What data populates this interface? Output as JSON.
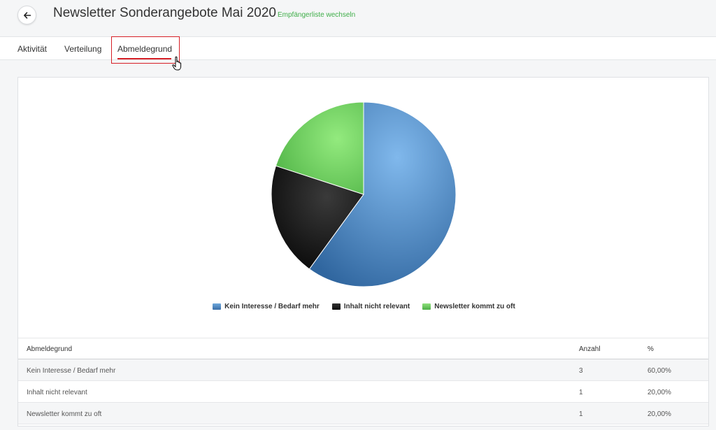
{
  "header": {
    "title": "Newsletter Sonderangebote Mai 2020",
    "switch_link": "Empfängerliste wechseln"
  },
  "tabs": [
    {
      "label": "Aktivität",
      "active": false
    },
    {
      "label": "Verteilung",
      "active": false
    },
    {
      "label": "Abmeldegrund",
      "active": true
    }
  ],
  "colors": {
    "accent_red": "#d61f26",
    "link_green": "#3fae49",
    "slice_blue": "#4a84c0",
    "slice_black": "#1a1a1a",
    "slice_green": "#6fd060"
  },
  "chart_data": {
    "type": "pie",
    "categories": [
      "Kein Interesse / Bedarf mehr",
      "Inhalt nicht relevant",
      "Newsletter kommt zu oft"
    ],
    "values": [
      3,
      1,
      1
    ],
    "colors": [
      "#4a84c0",
      "#1a1a1a",
      "#6fd060"
    ],
    "legend_position": "bottom"
  },
  "table": {
    "headers": [
      "Abmeldegrund",
      "Anzahl",
      "%"
    ],
    "rows": [
      [
        "Kein Interesse / Bedarf mehr",
        "3",
        "60,00%"
      ],
      [
        "Inhalt nicht relevant",
        "1",
        "20,00%"
      ],
      [
        "Newsletter kommt zu oft",
        "1",
        "20,00%"
      ]
    ]
  }
}
